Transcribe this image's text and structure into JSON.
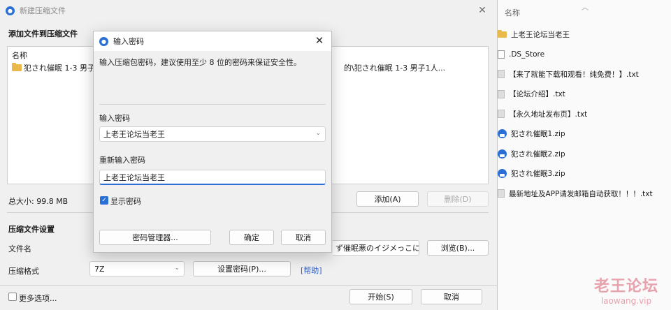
{
  "main_window": {
    "title": "新建压缩文件",
    "add_section_title": "添加文件到压缩文件",
    "files_column_header": "名称",
    "file_row_name": "犯され催眠 1-3 男子",
    "file_row_tail": "的\\犯され催眠 1-3 男子1人...",
    "total_size": "总大小: 99.8 MB",
    "add_button": "添加(A)",
    "delete_button": "删除(D)",
    "settings_title": "压缩文件设置",
    "filename_label": "文件名",
    "filename_value_tail": "ず催眠悪のイジメっこに辱",
    "browse_button": "浏览(B)...",
    "format_label": "压缩格式",
    "format_value": "7Z",
    "set_password_button": "设置密码(P)...",
    "help_link": "[帮助]",
    "more_options": "更多选项...",
    "start_button": "开始(S)",
    "cancel_button": "取消"
  },
  "password_dialog": {
    "title": "输入密码",
    "hint": "输入压缩包密码，建议使用至少 8 位的密码来保证安全性。",
    "password_label": "输入密码",
    "password_value": "上老王论坛当老王",
    "confirm_label": "重新输入密码",
    "confirm_value": "上老王论坛当老王",
    "show_password_label": "显示密码",
    "show_password_checked": true,
    "manager_button": "密码管理器...",
    "ok_button": "确定",
    "cancel_button": "取消"
  },
  "right_panel": {
    "header": "名称",
    "items": [
      {
        "name": "上老王论坛当老王",
        "icon": "folder-icon"
      },
      {
        "name": ".DS_Store",
        "icon": "file-icon"
      },
      {
        "name": "【来了就能下载和观看！纯免费！】.txt",
        "icon": "text-file-icon"
      },
      {
        "name": "【论坛介绍】.txt",
        "icon": "text-file-icon"
      },
      {
        "name": "【永久地址发布页】.txt",
        "icon": "text-file-icon"
      },
      {
        "name": "犯され催眠1.zip",
        "icon": "zip-file-icon"
      },
      {
        "name": "犯され催眠2.zip",
        "icon": "zip-file-icon"
      },
      {
        "name": "犯され催眠3.zip",
        "icon": "zip-file-icon"
      },
      {
        "name": "最新地址及APP请发邮箱自动获取！！！.txt",
        "icon": "text-file-icon"
      }
    ]
  },
  "watermark": {
    "name": "老王论坛",
    "url": "laowang.vip"
  },
  "colors": {
    "accent": "#2a6fd6",
    "watermark": "#e6a2ad"
  }
}
